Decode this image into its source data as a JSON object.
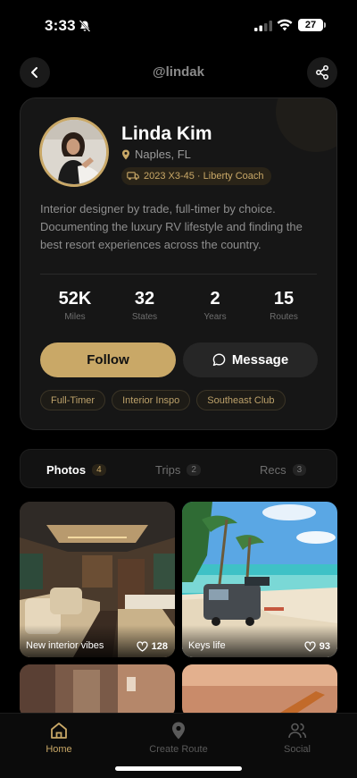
{
  "status": {
    "time": "3:33",
    "battery": "27"
  },
  "header": {
    "handle": "@lindak"
  },
  "profile": {
    "name": "Linda Kim",
    "location": "Naples, FL",
    "vehicle": "2023 X3-45 · Liberty Coach",
    "bio": "Interior designer by trade, full-timer by choice. Documenting the luxury RV lifestyle and finding the best resort experiences across the country.",
    "stats": [
      {
        "value": "52K",
        "label": "Miles"
      },
      {
        "value": "32",
        "label": "States"
      },
      {
        "value": "2",
        "label": "Years"
      },
      {
        "value": "15",
        "label": "Routes"
      }
    ],
    "follow_label": "Follow",
    "message_label": "Message",
    "tags": [
      "Full-Timer",
      "Interior Inspo",
      "Southeast Club"
    ]
  },
  "tabs": [
    {
      "label": "Photos",
      "count": "4",
      "active": true
    },
    {
      "label": "Trips",
      "count": "2",
      "active": false
    },
    {
      "label": "Recs",
      "count": "3",
      "active": false
    }
  ],
  "photos": [
    {
      "caption": "New interior vibes",
      "likes": "128"
    },
    {
      "caption": "Keys life",
      "likes": "93"
    }
  ],
  "bottom_nav": [
    {
      "label": "Home",
      "icon": "home-icon",
      "active": true
    },
    {
      "label": "Create Route",
      "icon": "map-pin-icon",
      "active": false
    },
    {
      "label": "Social",
      "icon": "users-icon",
      "active": false
    }
  ],
  "colors": {
    "accent": "#c9a867",
    "background": "#000000",
    "card": "#161616"
  }
}
